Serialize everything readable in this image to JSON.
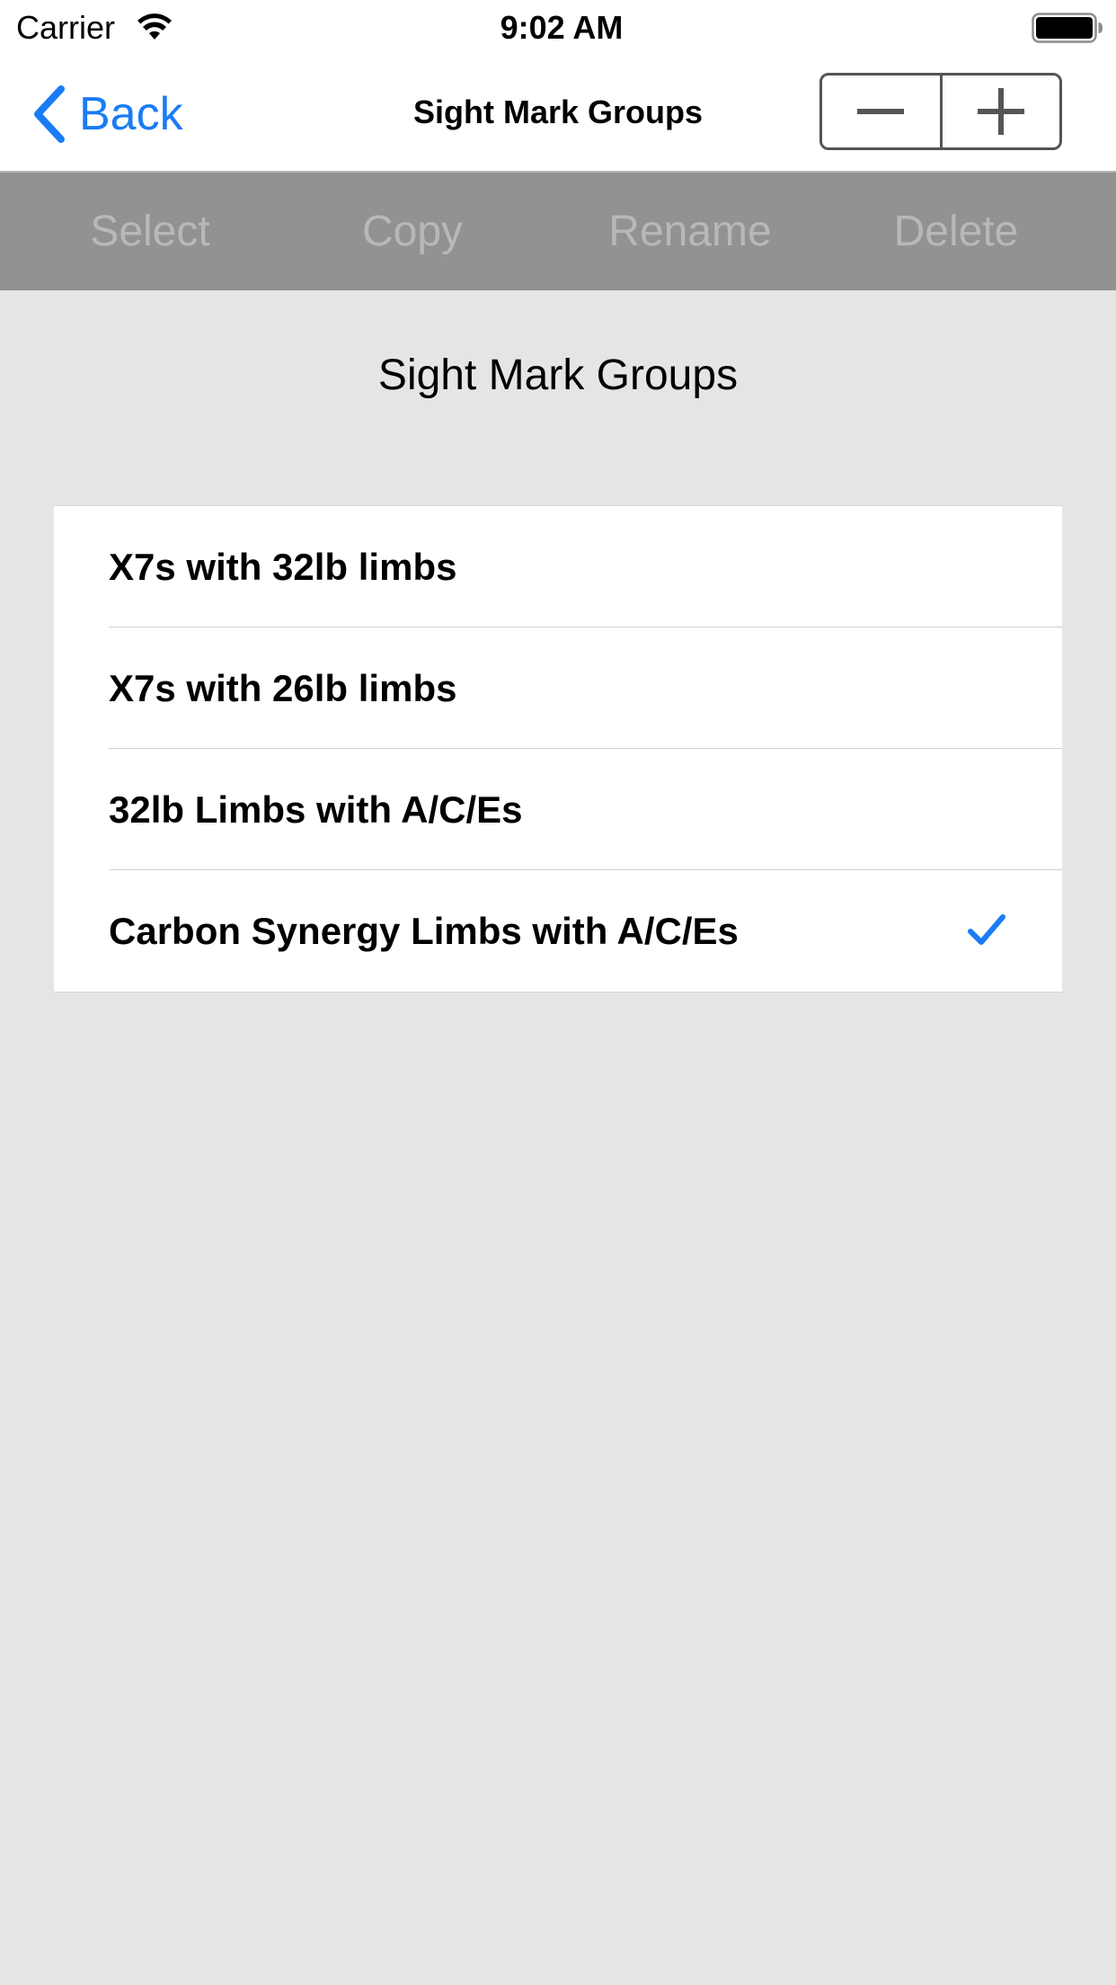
{
  "status_bar": {
    "carrier": "Carrier",
    "time": "9:02 AM",
    "wifi_icon": "wifi-icon",
    "battery_icon": "battery-full-icon"
  },
  "nav": {
    "back_label": "Back",
    "title": "Sight Mark Groups",
    "stepper": {
      "decrement_icon": "minus-icon",
      "increment_icon": "plus-icon"
    }
  },
  "toolbar": {
    "select_label": "Select",
    "copy_label": "Copy",
    "rename_label": "Rename",
    "delete_label": "Delete"
  },
  "main": {
    "title": "Sight Mark Groups",
    "items": [
      {
        "label": "X7s with 32lb limbs",
        "selected": false
      },
      {
        "label": "X7s with 26lb limbs",
        "selected": false
      },
      {
        "label": "32lb Limbs with A/C/Es",
        "selected": false
      },
      {
        "label": "Carbon Synergy Limbs with A/C/Es",
        "selected": true
      }
    ]
  },
  "colors": {
    "accent": "#1a7cf5",
    "toolbar_bg": "#929292",
    "toolbar_text_disabled": "#b8b8b8",
    "page_bg": "#e5e5e5"
  }
}
